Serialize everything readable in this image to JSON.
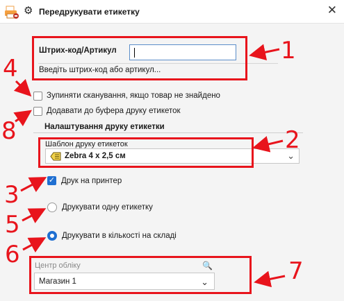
{
  "window": {
    "title": "Передрукувати етикетку",
    "close_glyph": "✕",
    "gear_glyph": "⚙",
    "app_icon": "printer-icon",
    "settings_icon": "gear-icon"
  },
  "barcode": {
    "label": "Штрих-код/Артикул",
    "value": "",
    "hint": "Введіть штрих-код або артикул..."
  },
  "options": {
    "stop_scanning": {
      "label": "Зупиняти сканування, якщо товар не знайдено",
      "checked": false
    },
    "add_to_buffer": {
      "label": "Додавати до буфера друку етикеток",
      "checked": false
    }
  },
  "print_settings": {
    "group_title": "Налаштування друку етикетки",
    "template_label": "Шаблон друку етикеток",
    "template_value": "Zebra 4 x 2,5 см",
    "template_icon": "label-tag-icon",
    "print_to_printer": {
      "label": "Друк на принтер",
      "checked": true
    },
    "print_mode": {
      "options": [
        "Друкувати одну етикетку",
        "Друкувати в кількості на складі"
      ],
      "selected": "Друкувати в кількості на складі"
    }
  },
  "accounting_center": {
    "label": "Центр обліку",
    "value": "Магазин 1",
    "search_icon": "search-icon"
  },
  "annotations": {
    "numbers": [
      "1",
      "2",
      "3",
      "4",
      "5",
      "6",
      "7",
      "8"
    ],
    "color": "#e8141c"
  },
  "colors": {
    "accent": "#1f6fd1",
    "annotation_red": "#e8141c",
    "panel_bg": "#f4f4f4"
  }
}
